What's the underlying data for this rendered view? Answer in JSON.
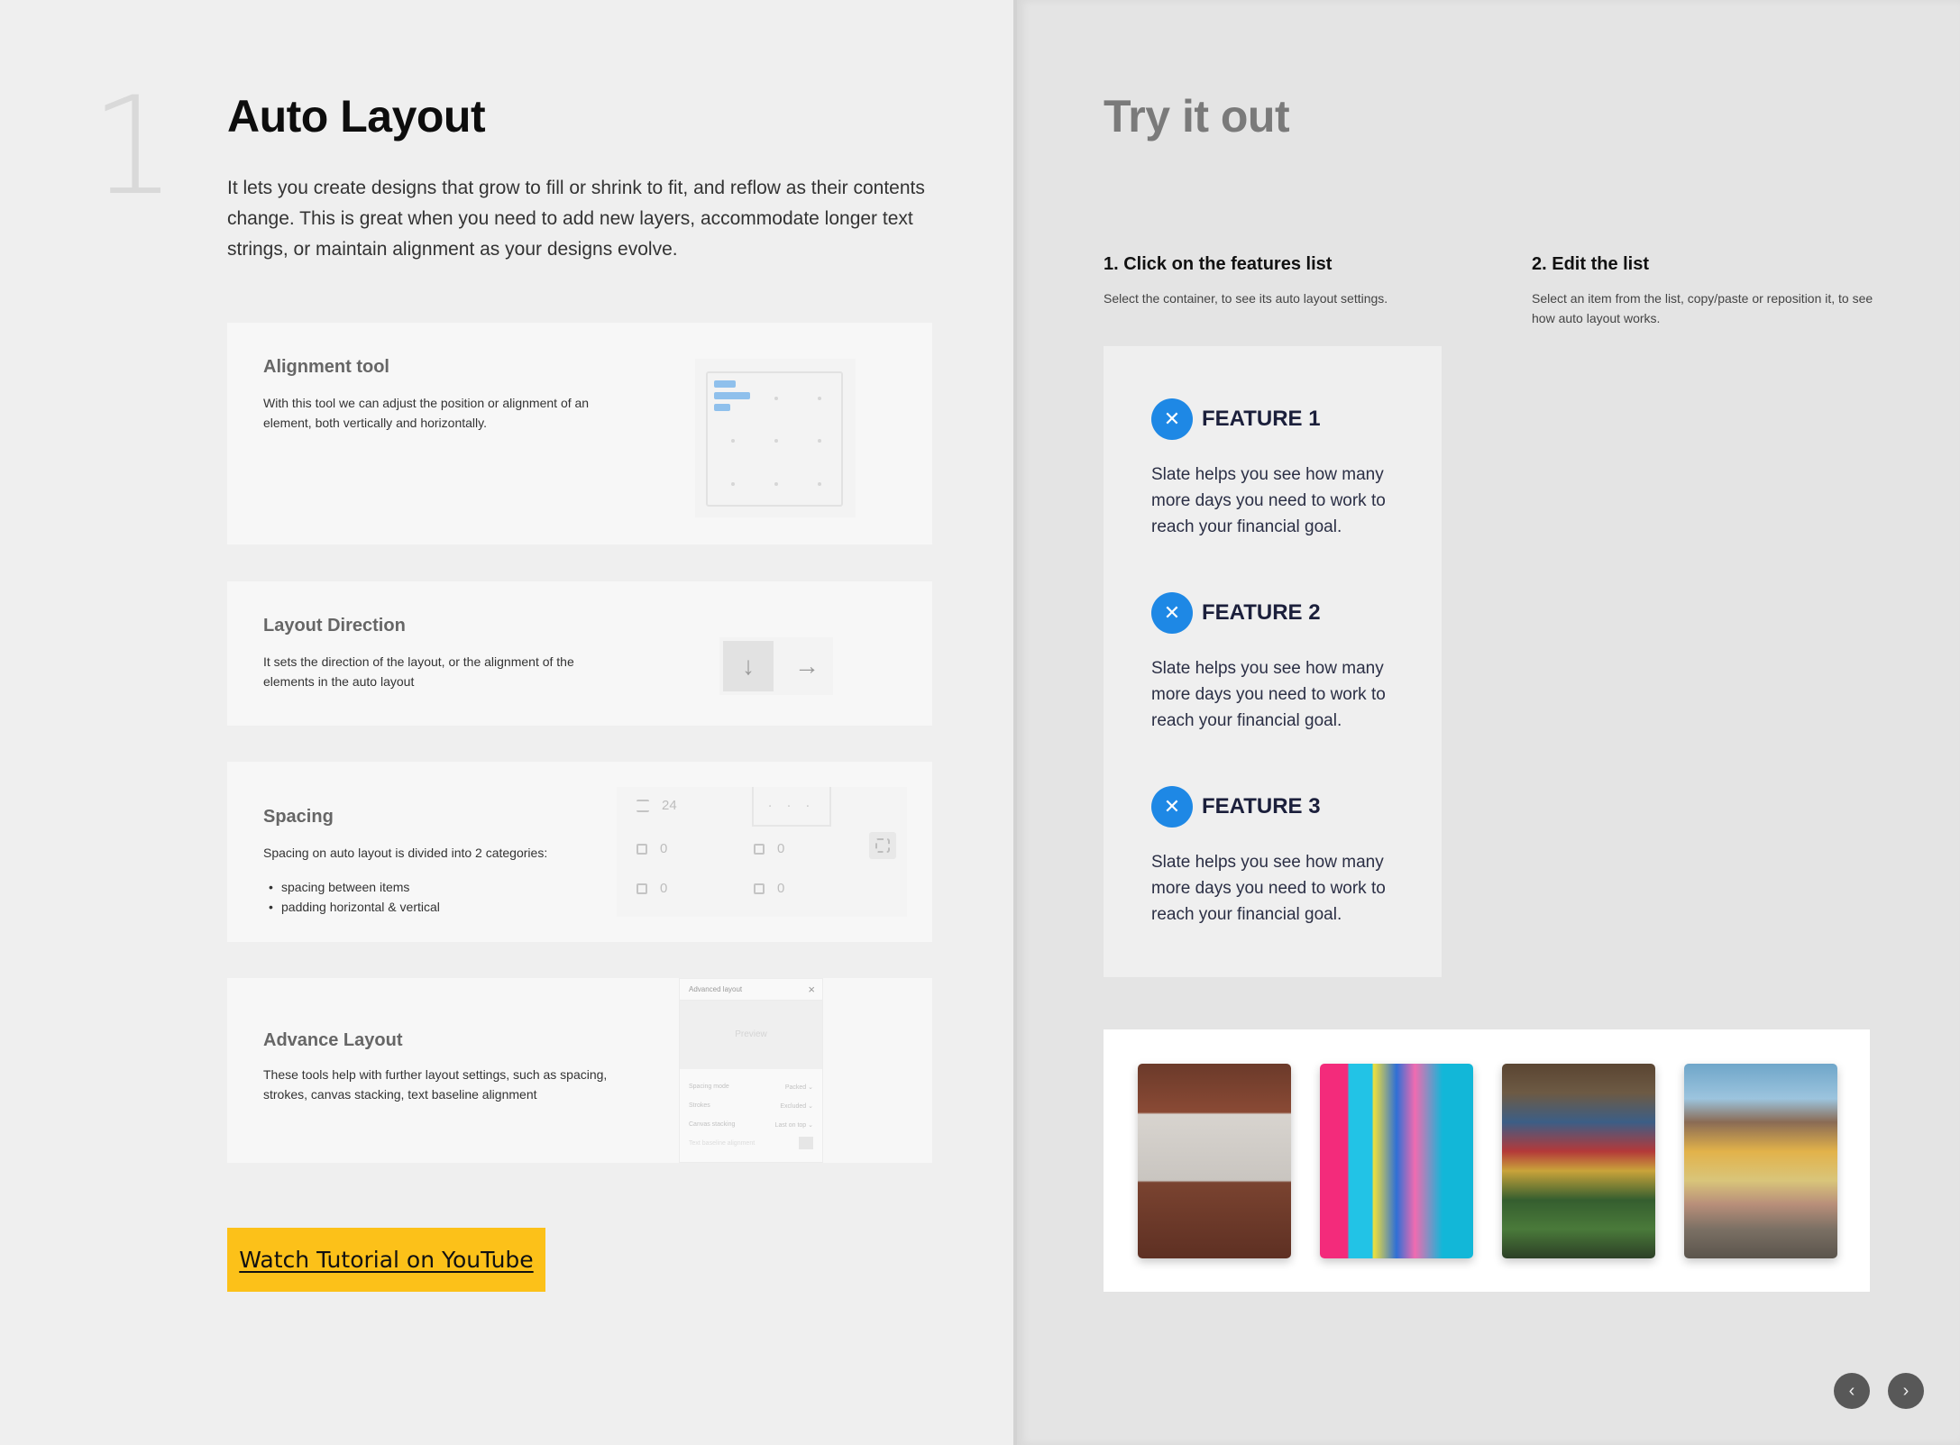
{
  "left": {
    "step_number": "1",
    "title": "Auto Layout",
    "intro": "It lets you create designs that grow to fill or shrink to fit, and reflow as their contents change. This is great when you need to add new layers, accommodate longer text strings, or maintain alignment as your designs evolve.",
    "cards": {
      "alignment": {
        "title": "Alignment tool",
        "desc": "With this tool we can adjust the position or alignment of an element, both vertically and horizontally."
      },
      "direction": {
        "title": "Layout Direction",
        "desc": "It sets the direction of the layout, or the alignment of the elements in the auto layout",
        "down_glyph": "↓",
        "right_glyph": "→"
      },
      "spacing": {
        "title": "Spacing",
        "desc": "Spacing on auto layout is divided into 2 categories:",
        "bullets": [
          "spacing between items",
          "padding horizontal & vertical"
        ],
        "widget": {
          "item_spacing": "24",
          "pad_left": "0",
          "pad_top": "0",
          "pad_right": "0",
          "pad_bottom": "0",
          "dots": ". . ."
        }
      },
      "advanced": {
        "title": "Advance Layout",
        "desc": "These tools help with further layout settings, such as spacing, strokes, canvas stacking, text baseline alignment",
        "widget": {
          "header": "Advanced layout",
          "close": "×",
          "preview": "Preview",
          "rows": [
            {
              "label": "Spacing mode",
              "value": "Packed ⌄"
            },
            {
              "label": "Strokes",
              "value": "Excluded ⌄"
            },
            {
              "label": "Canvas stacking",
              "value": "Last on top ⌄"
            },
            {
              "label": "Text baseline alignment",
              "value": ""
            }
          ]
        }
      }
    },
    "youtube_button": "Watch Tutorial on YouTube"
  },
  "right": {
    "title": "Try it out",
    "step1": {
      "title": "1. Click on the features list",
      "desc": "Select the container, to see its auto layout settings."
    },
    "step2": {
      "title": "2. Edit the list",
      "desc": "Select an item from the list, copy/paste or reposition it, to see how auto layout works."
    },
    "features": [
      {
        "title": "FEATURE 1",
        "text": "Slate helps you see how many more days you need to work to reach your financial goal.",
        "icon": "utensils-icon"
      },
      {
        "title": "FEATURE 2",
        "text": "Slate helps you see how many more days you need to work to reach your financial goal.",
        "icon": "utensils-icon"
      },
      {
        "title": "FEATURE 3",
        "text": "Slate helps you see how many more days you need to work to reach your financial goal.",
        "icon": "utensils-icon"
      }
    ],
    "feature_icon_glyph": "✕",
    "nav": {
      "prev": "‹",
      "next": "›"
    }
  },
  "colors": {
    "accent_blue": "#1e88e5",
    "youtube_yellow": "#fcc119",
    "alignment_bar": "#8fc0ec"
  }
}
